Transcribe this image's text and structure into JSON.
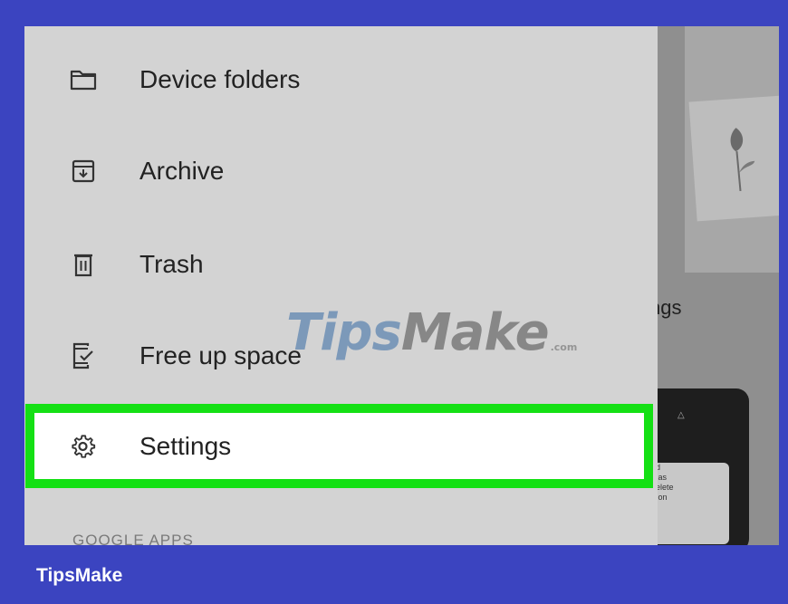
{
  "drawer": {
    "items": [
      {
        "label": "Device folders",
        "icon": "folder-icon"
      },
      {
        "label": "Archive",
        "icon": "archive-icon"
      },
      {
        "label": "Trash",
        "icon": "trash-icon"
      },
      {
        "label": "Free up space",
        "icon": "free-up-space-icon"
      },
      {
        "label": "Settings",
        "icon": "gear-icon",
        "highlighted": true
      }
    ],
    "section_header": "GOOGLE APPS"
  },
  "background": {
    "partial_heading": "ngs",
    "card_lines": [
      "nd",
      "n as",
      "delete",
      "d on"
    ]
  },
  "watermark": {
    "part1": "Tips",
    "part2": "Make",
    "suffix": ".com"
  },
  "footer": {
    "brand": "TipsMake"
  },
  "colors": {
    "frame_border": "#3b44c0",
    "drawer_bg": "#d3d3d3",
    "highlight": "#14e014"
  }
}
